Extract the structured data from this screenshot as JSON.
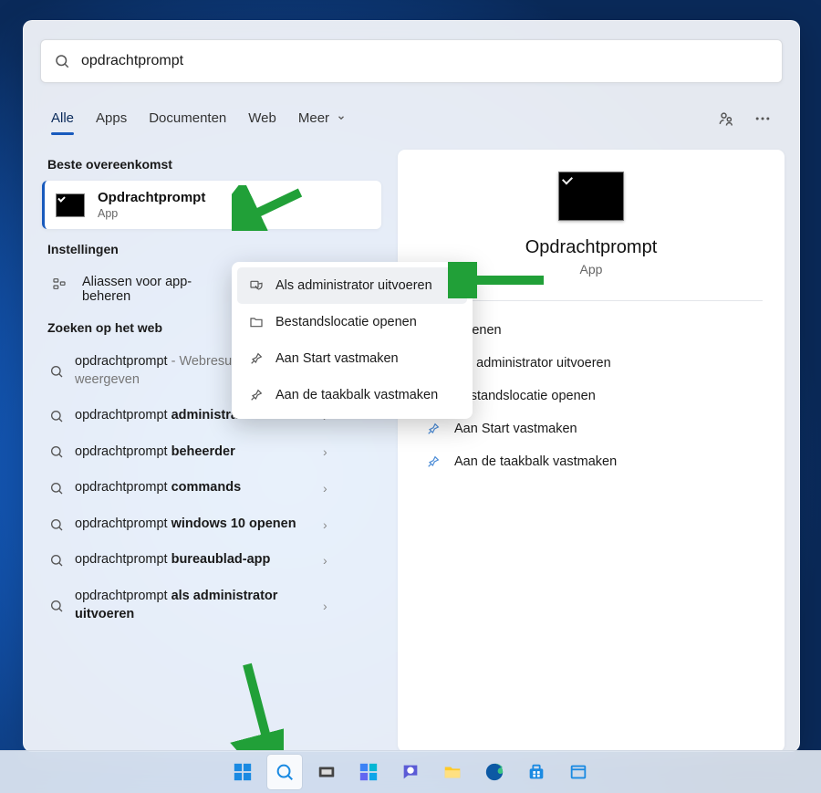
{
  "search": {
    "query": "opdrachtprompt"
  },
  "tabs": {
    "all": "Alle",
    "apps": "Apps",
    "docs": "Documenten",
    "web": "Web",
    "more": "Meer"
  },
  "sections": {
    "best": "Beste overeenkomst",
    "settings": "Instellingen",
    "web": "Zoeken op het web"
  },
  "best_match": {
    "title": "Opdrachtprompt",
    "subtitle": "App"
  },
  "settings_items": [
    {
      "label": "Aliassen voor app-beheren"
    }
  ],
  "web_results": [
    {
      "prefix": "opdrachtprompt",
      "suffix_muted": " - Webresultaten weergeven",
      "bold": ""
    },
    {
      "prefix": "opdrachtprompt ",
      "bold": "administrator"
    },
    {
      "prefix": "opdrachtprompt ",
      "bold": "beheerder"
    },
    {
      "prefix": "opdrachtprompt ",
      "bold": "commands"
    },
    {
      "prefix": "opdrachtprompt ",
      "bold": "windows 10 openen"
    },
    {
      "prefix": "opdrachtprompt ",
      "bold": "bureaublad-app"
    },
    {
      "prefix": "opdrachtprompt ",
      "bold": "als administrator uitvoeren"
    }
  ],
  "context_menu": [
    {
      "icon": "admin-shield-icon",
      "label": "Als administrator uitvoeren",
      "selected": true
    },
    {
      "icon": "folder-icon",
      "label": "Bestandslocatie openen"
    },
    {
      "icon": "pin-icon",
      "label": "Aan Start vastmaken"
    },
    {
      "icon": "pin-icon",
      "label": "Aan de taakbalk vastmaken"
    }
  ],
  "preview": {
    "title": "Opdrachtprompt",
    "subtitle": "App",
    "actions": [
      {
        "icon": "open-icon",
        "label": "Openen"
      },
      {
        "icon": "admin-shield-icon",
        "label": "Als administrator uitvoeren"
      },
      {
        "icon": "folder-icon",
        "label": "Bestandslocatie openen"
      },
      {
        "icon": "pin-icon",
        "label": "Aan Start vastmaken"
      },
      {
        "icon": "pin-icon",
        "label": "Aan de taakbalk vastmaken"
      }
    ]
  },
  "colors": {
    "accent": "#185abd",
    "arrow": "#21a038"
  }
}
